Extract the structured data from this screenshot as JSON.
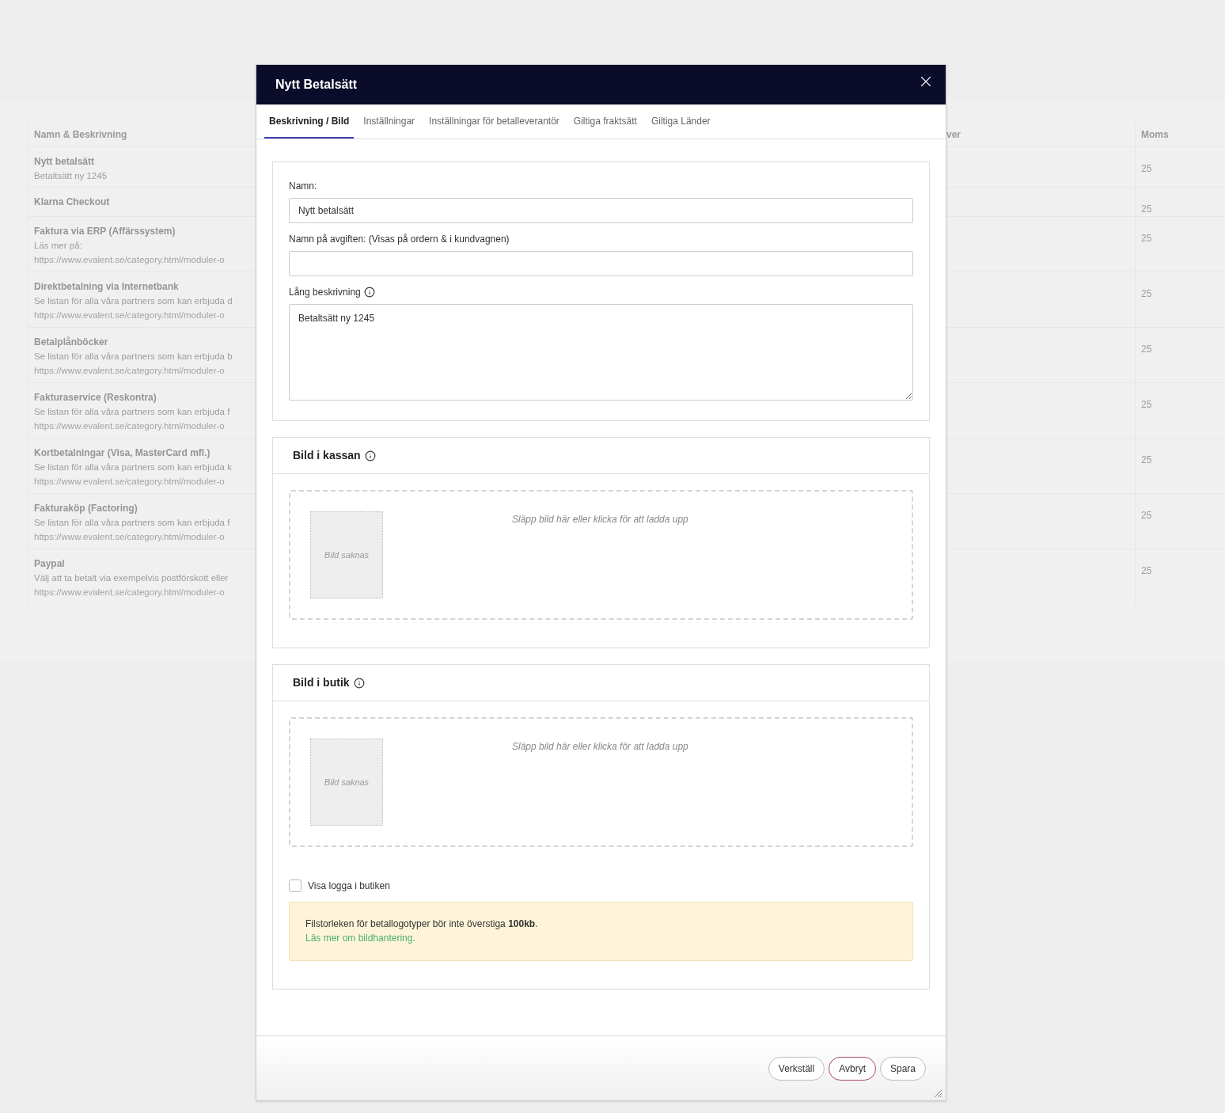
{
  "background_table": {
    "columns": [
      {
        "label": "Namn & Beskrivning"
      },
      {
        "label": "ver"
      },
      {
        "label": "Moms"
      }
    ],
    "rows": [
      {
        "name": "Nytt betalsätt",
        "lines": [
          "Betaltsätt ny 1245"
        ],
        "moms": "25"
      },
      {
        "name": "Klarna Checkout",
        "lines": [],
        "moms": "25"
      },
      {
        "name": "Faktura via ERP (Affärssystem)",
        "lines": [
          "Läs mer på:",
          "https://www.evalent.se/category.html/moduler-o"
        ],
        "moms": "25"
      },
      {
        "name": "Direktbetalning via Internetbank",
        "lines": [
          "Se listan för alla våra partners som kan erbjuda d",
          "https://www.evalent.se/category.html/moduler-o"
        ],
        "moms": "25"
      },
      {
        "name": "Betalplånböcker",
        "lines": [
          "Se listan för alla våra partners som kan erbjuda b",
          "https://www.evalent.se/category.html/moduler-o"
        ],
        "moms": "25"
      },
      {
        "name": "Fakturaservice (Reskontra)",
        "lines": [
          "Se listan för alla våra partners som kan erbjuda f",
          "https://www.evalent.se/category.html/moduler-o"
        ],
        "moms": "25"
      },
      {
        "name": "Kortbetalningar (Visa, MasterCard mfl.)",
        "lines": [
          "Se listan för alla våra partners som kan erbjuda k",
          "https://www.evalent.se/category.html/moduler-o"
        ],
        "moms": "25"
      },
      {
        "name": "Fakturaköp (Factoring)",
        "lines": [
          "Se listan för alla våra partners som kan erbjuda f",
          "https://www.evalent.se/category.html/moduler-o"
        ],
        "moms": "25"
      },
      {
        "name": "Paypal",
        "lines": [
          "Välj att ta betalt via exempelvis postförskott eller",
          "https://www.evalent.se/category.html/moduler-o"
        ],
        "moms": "25"
      }
    ]
  },
  "modal": {
    "title": "Nytt Betalsätt",
    "tabs": [
      {
        "label": "Beskrivning / Bild",
        "selected": true
      },
      {
        "label": "Inställningar",
        "selected": false
      },
      {
        "label": "Inställningar för betalleverantör",
        "selected": false
      },
      {
        "label": "Giltiga fraktsätt",
        "selected": false
      },
      {
        "label": "Giltiga Länder",
        "selected": false
      }
    ],
    "name_field": {
      "label": "Namn:",
      "value": "Nytt betalsätt"
    },
    "fee_field": {
      "label": "Namn på avgiften: (Visas på ordern & i kundvagnen)"
    },
    "description_field": {
      "label": "Lång beskrivning",
      "value": "Betaltsätt ny 1245"
    },
    "image_sections": [
      {
        "title": "Bild i kassan",
        "drop_text": "Släpp bild här eller klicka för att ladda upp",
        "missing_text": "Bild saknas"
      },
      {
        "title": "Bild i butik",
        "drop_text": "Släpp bild här eller klicka för att ladda upp",
        "missing_text": "Bild saknas"
      }
    ],
    "checkbox": {
      "label": "Visa logga i butiken",
      "checked": false
    },
    "notice": {
      "text": "Filstorleken för betallogotyper bör inte överstiga **100kb**.",
      "link": "Läs mer om bildhantering."
    },
    "buttons": [
      {
        "label": "Verkställ",
        "kind": "default"
      },
      {
        "label": "Avbryt",
        "kind": "cancel"
      },
      {
        "label": "Spara",
        "kind": "default"
      }
    ]
  }
}
